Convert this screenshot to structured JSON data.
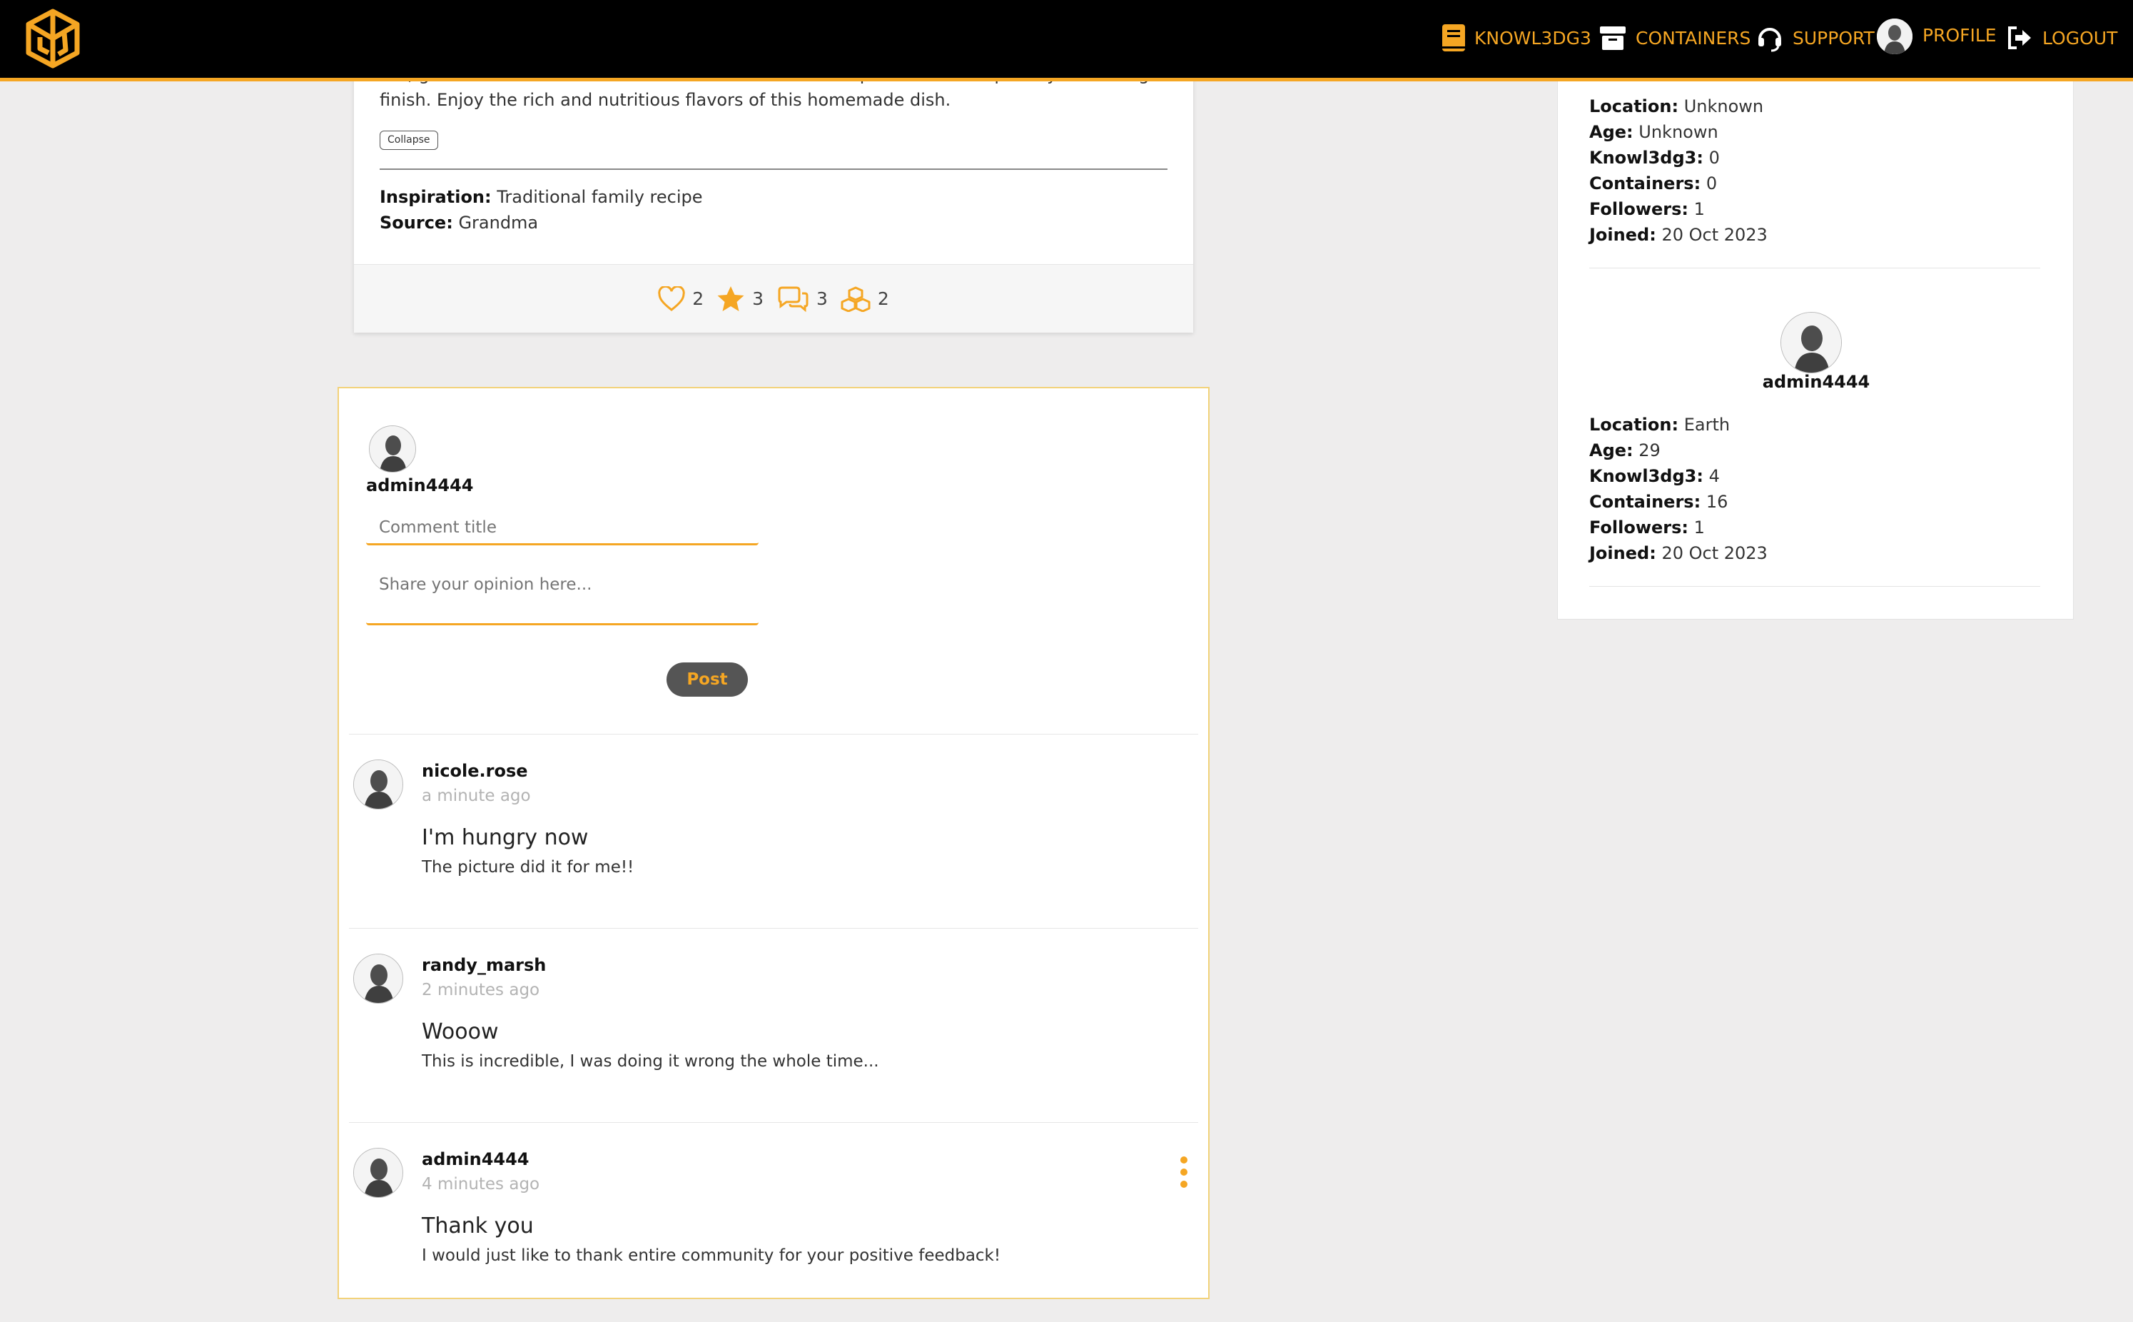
{
  "nav": {
    "knowledge_label": "KNOWL3DG3",
    "containers_label": "CONTAINERS",
    "support_label": "SUPPORT",
    "profile_label": "PROFILE",
    "logout_label": "LOGOUT"
  },
  "post": {
    "clipped_text": "hot, garnished with additional Parmesan cheese and a sprinkle of fresh parsley for a delightful",
    "text_end": "finish. Enjoy the rich and nutritious flavors of this homemade dish.",
    "collapse_label": "Collapse",
    "inspiration_label": "Inspiration:",
    "inspiration_value": "Traditional family recipe",
    "source_label": "Source:",
    "source_value": "Grandma",
    "stats": {
      "likes": "2",
      "stars": "3",
      "comments": "3",
      "shares": "2"
    }
  },
  "composer": {
    "username": "admin4444",
    "title_placeholder": "Comment title",
    "body_placeholder": "Share your opinion here...",
    "post_label": "Post"
  },
  "comments": [
    {
      "user": "nicole.rose",
      "time": "a minute ago",
      "title": "I'm hungry now",
      "body": "The picture did it for me!!"
    },
    {
      "user": "randy_marsh",
      "time": "2 minutes ago",
      "title": "Wooow",
      "body": "This is incredible, I was doing it wrong the whole time..."
    },
    {
      "user": "admin4444",
      "time": "4 minutes ago",
      "title": "Thank you",
      "body": "I would just like to thank entire community for your positive feedback!"
    }
  ],
  "sidebar": {
    "labels": {
      "location": "Location:",
      "age": "Age:",
      "knowledge": "Knowl3dg3:",
      "containers": "Containers:",
      "followers": "Followers:",
      "joined": "Joined:"
    },
    "author": {
      "location": "Unknown",
      "age": "Unknown",
      "knowledge": "0",
      "containers": "0",
      "followers": "1",
      "joined": "20 Oct 2023"
    },
    "viewer": {
      "username": "admin4444",
      "location": "Earth",
      "age": "29",
      "knowledge": "4",
      "containers": "16",
      "followers": "1",
      "joined": "20 Oct 2023"
    }
  },
  "colors": {
    "accent": "#f5a623",
    "navbar": "#000000",
    "background": "#eeeded"
  }
}
